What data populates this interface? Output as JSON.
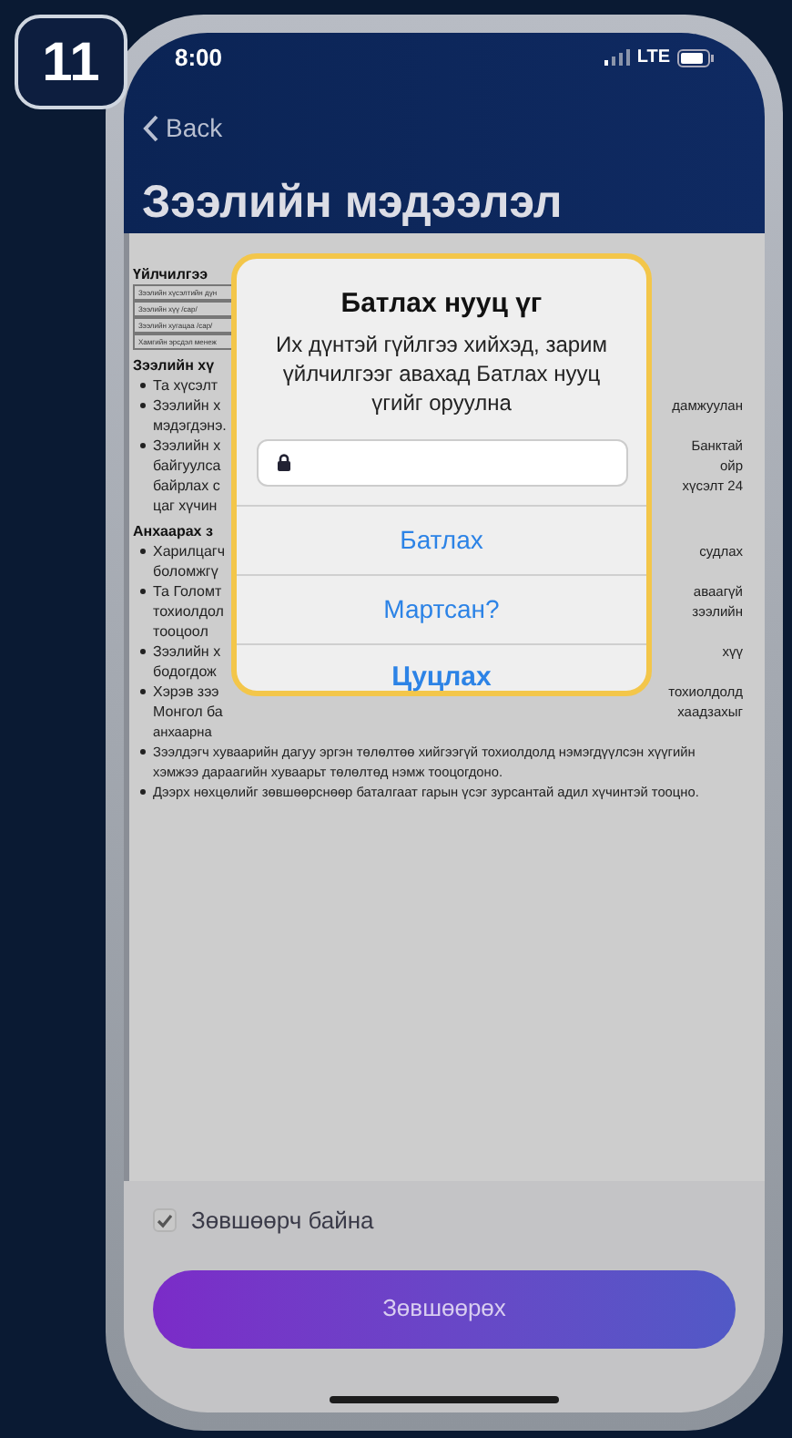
{
  "step_badge": "11",
  "status_bar": {
    "time": "8:00",
    "network": "LTE"
  },
  "nav": {
    "back": "Back"
  },
  "title": "Зээлийн мэдээлэл",
  "document": [
    {
      "kind": "heading",
      "left": "Үйлчилгээ"
    },
    {
      "kind": "table_row",
      "left": "Зээлийн хүсэлтийн дүн"
    },
    {
      "kind": "table_row",
      "left": "Зээлийн хүү /сар/"
    },
    {
      "kind": "table_row",
      "left": "Зээлийн хугацаа /сар/"
    },
    {
      "kind": "table_row",
      "left": "Хамгийн эрсдэл менеж"
    },
    {
      "kind": "heading",
      "left": "Зээлийн хү"
    },
    {
      "kind": "bullet",
      "left": "Та хүсэлт"
    },
    {
      "kind": "bullet",
      "left": "Зээлийн х",
      "right": "дамжуулан"
    },
    {
      "kind": "continuation",
      "left": "мэдэгдэнэ."
    },
    {
      "kind": "bullet",
      "left": "Зээлийн х",
      "right": "Банктай"
    },
    {
      "kind": "continuation",
      "left": "байгуулса",
      "right": "ойр"
    },
    {
      "kind": "continuation",
      "left": "байрлах с",
      "right": "хүсэлт 24"
    },
    {
      "kind": "continuation",
      "left": "цаг хүчин"
    },
    {
      "kind": "heading",
      "left": "Анхаарах з"
    },
    {
      "kind": "bullet",
      "left": "Харилцагч",
      "right": "судлах"
    },
    {
      "kind": "continuation",
      "left": "боломжгү"
    },
    {
      "kind": "bullet",
      "left": "Та Голомт",
      "right": "аваагүй"
    },
    {
      "kind": "continuation",
      "left": "тохиолдол",
      "right": "зээлийн"
    },
    {
      "kind": "continuation",
      "left": "тооцоол"
    },
    {
      "kind": "bullet",
      "left": "Зээлийн х",
      "right": "хүү"
    },
    {
      "kind": "continuation",
      "left": "бодогдож"
    },
    {
      "kind": "bullet",
      "left": "Хэрэв зээ",
      "right": "тохиолдолд"
    },
    {
      "kind": "continuation",
      "left": "Монгол ба",
      "right": "хаадзахыг"
    },
    {
      "kind": "continuation",
      "left": "анхаарна"
    },
    {
      "kind": "bullet",
      "left": "Зээлдэгч хуваарийн дагуу эргэн төлөлтөө хийгээгүй тохиолдолд нэмэгдүүлсэн хүүгийн"
    },
    {
      "kind": "continuation",
      "left": "хэмжээ дараагийн хуваарьт төлөлтөд нэмж тооцогдоно."
    },
    {
      "kind": "bullet",
      "left": "Дээрх нөхцөлийг зөвшөөрснөөр баталгаат гарын үсэг зурсантай адил хүчинтэй тооцно."
    }
  ],
  "dialog": {
    "title": "Батлах нууц үг",
    "message": "Их дүнтэй гүйлгээ хийхэд, зарим үйлчилгээг авахад Батлах нууц үгийг оруулна",
    "actions": [
      {
        "label": "Батлах",
        "kind": "normal"
      },
      {
        "label": "Мартсан?",
        "kind": "normal"
      },
      {
        "label": "Цуцлах",
        "kind": "cancel"
      }
    ]
  },
  "consent": {
    "label": "Зөвшөөрч байна",
    "checked": true
  },
  "submit_button": "Зөвшөөрөх"
}
